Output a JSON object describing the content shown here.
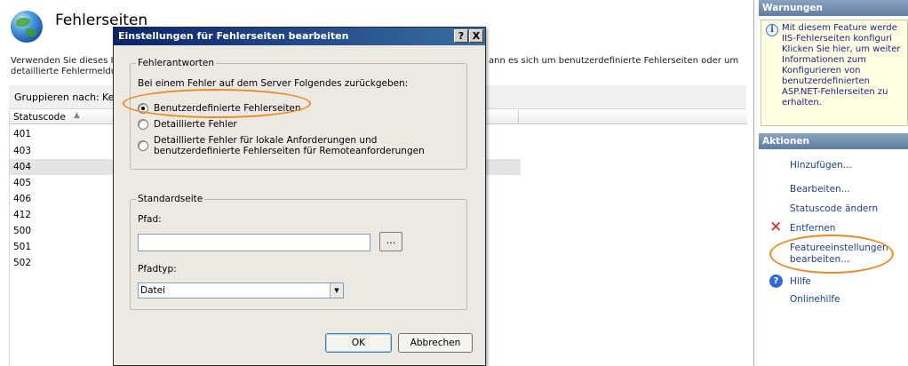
{
  "page": {
    "title": "Fehlerseiten",
    "description_line1_left": "Verwenden Sie dieses I",
    "description_line1_right": "ann es sich um benutzerdefinierte Fehlerseiten oder um",
    "description_line2": "detaillierte Fehlermeldu",
    "group_by_label": "Gruppieren nach:",
    "group_by_value": "Ke",
    "list": {
      "column_header": "Statuscode",
      "sort_glyph": "▲",
      "rows": [
        "401",
        "403",
        "404",
        "405",
        "406",
        "412",
        "500",
        "501",
        "502"
      ],
      "selected_row": "404"
    }
  },
  "dialog": {
    "title": "Einstellungen für Fehlerseiten bearbeiten",
    "help_button": "?",
    "close_button": "X",
    "error_responses": {
      "legend": "Fehlerantworten",
      "intro": "Bei einem Fehler auf dem Server Folgendes zurückgeben:",
      "options": [
        "Benutzerdefinierte Fehlerseiten",
        "Detaillierte Fehler",
        "Detaillierte Fehler für lokale Anforderungen und",
        "benutzerdefinierte Fehlerseiten für Remoteanforderungen"
      ],
      "selected": "Benutzerdefinierte Fehlerseiten"
    },
    "default_page": {
      "legend": "Standardseite",
      "path_label": "Pfad:",
      "path_value": "",
      "browse_button": "...",
      "path_type_label": "Pfadtyp:",
      "path_type_value": "Datei"
    },
    "ok_button": "OK",
    "cancel_button": "Abbrechen"
  },
  "actions_pane": {
    "warnings_header": "Warnungen",
    "warning_text": "Mit diesem Feature werde IIS-Fehlerseiten konfiguri Klicken Sie hier, um weiter Informationen zum Konfigurieren von benutzerdefinierten ASP.NET-Fehlerseiten zu erhalten.",
    "actions_header": "Aktionen",
    "items": [
      "Hinzufügen...",
      "Bearbeiten...",
      "Statuscode ändern",
      "Entfernen",
      "Featureeinstellungen",
      "bearbeiten...",
      "Hilfe",
      "Onlinehilfe"
    ]
  },
  "colors": {
    "title_bar_start": "#0a246a",
    "title_bar_end": "#3a6ea5",
    "highlight": "#ee8a26",
    "link": "#1b3f91",
    "remove_icon": "#d8261c"
  }
}
